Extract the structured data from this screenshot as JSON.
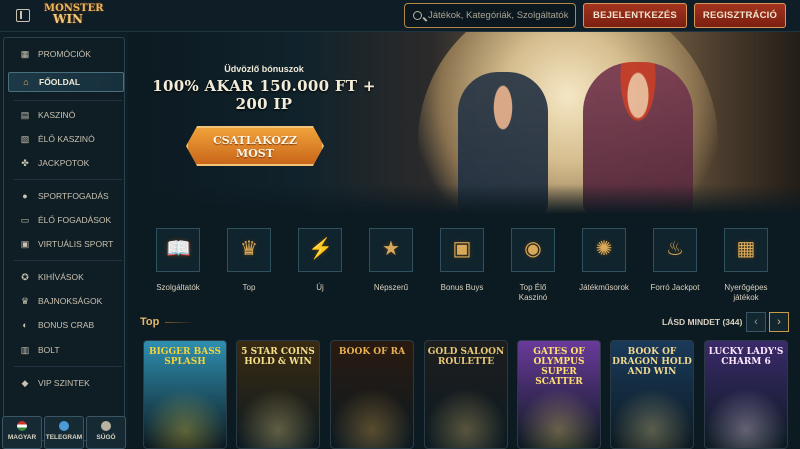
{
  "header": {
    "logo_line1": "MONSTER",
    "logo_line2": "WIN",
    "search_placeholder": "Játékok, Kategóriák, Szolgáltatók",
    "login_label": "BEJELENTKEZÉS",
    "register_label": "REGISZTRÁCIÓ"
  },
  "sidebar": {
    "items": [
      {
        "label": "PROMÓCIÓK",
        "icon": "gift-icon"
      },
      {
        "label": "FŐOLDAL",
        "icon": "home-icon"
      },
      {
        "label": "KASZINÓ",
        "icon": "slot-icon"
      },
      {
        "label": "ÉLŐ KASZINÓ",
        "icon": "cards-icon"
      },
      {
        "label": "JACKPOTOK",
        "icon": "clover-icon"
      },
      {
        "label": "SPORTFOGADÁS",
        "icon": "ball-icon"
      },
      {
        "label": "ÉLŐ FOGADÁSOK",
        "icon": "live-icon"
      },
      {
        "label": "VIRTUÁLIS SPORT",
        "icon": "screen-icon"
      },
      {
        "label": "KIHÍVÁSOK",
        "icon": "medal-icon"
      },
      {
        "label": "BAJNOKSÁGOK",
        "icon": "trophy-icon"
      },
      {
        "label": "BONUS CRAB",
        "icon": "crab-icon"
      },
      {
        "label": "BOLT",
        "icon": "shop-icon"
      },
      {
        "label": "VIP SZINTEK",
        "icon": "diamond-icon"
      }
    ],
    "bottom": [
      {
        "label": "MAGYAR",
        "icon": "flag-hu-icon"
      },
      {
        "label": "TELEGRAM",
        "icon": "telegram-icon"
      },
      {
        "label": "SÚGÓ",
        "icon": "help-icon"
      }
    ]
  },
  "banner": {
    "subtitle": "Üdvözlő bónuszok",
    "title_line1": "100% AKAR 150.000 FT +",
    "title_line2": "200 IP",
    "cta_line1": "CSATLAKOZZ",
    "cta_line2": "MOST"
  },
  "categories": [
    {
      "label": "Szolgáltatók",
      "icon": "book-icon",
      "glyph": "📖"
    },
    {
      "label": "Top",
      "icon": "crown-icon",
      "glyph": "♛"
    },
    {
      "label": "Új",
      "icon": "lightning-icon",
      "glyph": "⚡"
    },
    {
      "label": "Népszerű",
      "icon": "star-icon",
      "glyph": "★"
    },
    {
      "label": "Bonus Buys",
      "icon": "chest-icon",
      "glyph": "▣"
    },
    {
      "label": "Top Élő Kaszinó",
      "icon": "chip-icon",
      "glyph": "◉"
    },
    {
      "label": "Játékműsorok",
      "icon": "wheel-icon",
      "glyph": "✺"
    },
    {
      "label": "Forró Jackpot",
      "icon": "flame-icon",
      "glyph": "♨"
    },
    {
      "label": "Nyerőgépes játékok",
      "icon": "slot-machine-icon",
      "glyph": "▦"
    }
  ],
  "games_section": {
    "title": "Top",
    "see_all": "LÁSD MINDET (344)",
    "games": [
      {
        "title": "BIGGER BASS SPLASH",
        "bg": "#2f8fb0",
        "color": "#f3d23a"
      },
      {
        "title": "5 STAR COINS HOLD & WIN",
        "bg": "#3a2a12",
        "color": "#f6e08a"
      },
      {
        "title": "BOOK OF RA",
        "bg": "#2a1a10",
        "color": "#e8b050"
      },
      {
        "title": "GOLD SALOON ROULETTE",
        "bg": "#1e1e1e",
        "color": "#e8c878"
      },
      {
        "title": "GATES OF OLYMPUS SUPER SCATTER",
        "bg": "#6a3a9a",
        "color": "#ffe070"
      },
      {
        "title": "BOOK OF DRAGON HOLD AND WIN",
        "bg": "#1a3a5a",
        "color": "#f0d890"
      },
      {
        "title": "LUCKY LADY'S CHARM 6",
        "bg": "#3a2a6a",
        "color": "#ffe8ff"
      }
    ]
  }
}
